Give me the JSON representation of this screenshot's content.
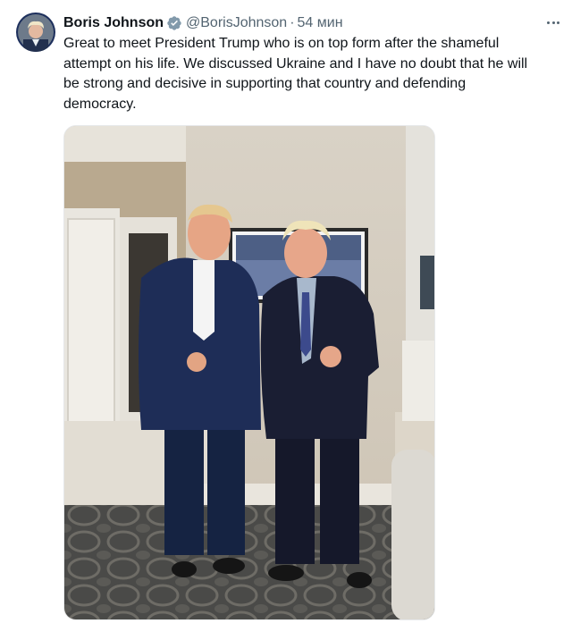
{
  "author": {
    "name": "Boris Johnson",
    "handle": "@BorisJohnson",
    "separator": "·",
    "time": "54 мин",
    "verified_color": "#829aab"
  },
  "tweet": {
    "text": "Great to meet President Trump who is on top form after the shameful\nattempt on his life. We discussed Ukraine and I have no doubt that he will\nbe strong and decisive in supporting that country and defending\ndemocracy."
  },
  "icons": {
    "verified": "verified-badge-icon",
    "more": "more-options-icon"
  },
  "colors": {
    "text_primary": "#0f1419",
    "text_secondary": "#536471"
  }
}
